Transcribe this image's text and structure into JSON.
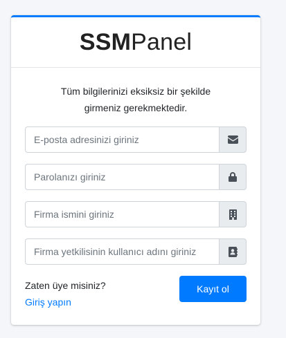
{
  "brand": {
    "bold_part": "SSM",
    "light_part": "Panel"
  },
  "message": {
    "line1": "Tüm bilgilerinizi eksiksiz bir şekilde",
    "line2": "girmeniz gerekmektedir."
  },
  "form": {
    "email": {
      "placeholder": "E-posta adresinizi giriniz",
      "value": "",
      "icon": "envelope-icon"
    },
    "password": {
      "placeholder": "Parolanızı giriniz",
      "value": "",
      "icon": "lock-icon"
    },
    "company": {
      "placeholder": "Firma ismini giriniz",
      "value": "",
      "icon": "building-icon"
    },
    "username": {
      "placeholder": "Firma yetkilisinin kullanıcı adını giriniz",
      "value": "",
      "icon": "address-book-icon"
    }
  },
  "footer": {
    "already_member": "Zaten üye misiniz?",
    "login_link": "Giriş yapın",
    "register_button": "Kayıt ol"
  },
  "colors": {
    "accent": "#007bff",
    "addon_bg": "#e9ecef",
    "icon": "#495057"
  }
}
